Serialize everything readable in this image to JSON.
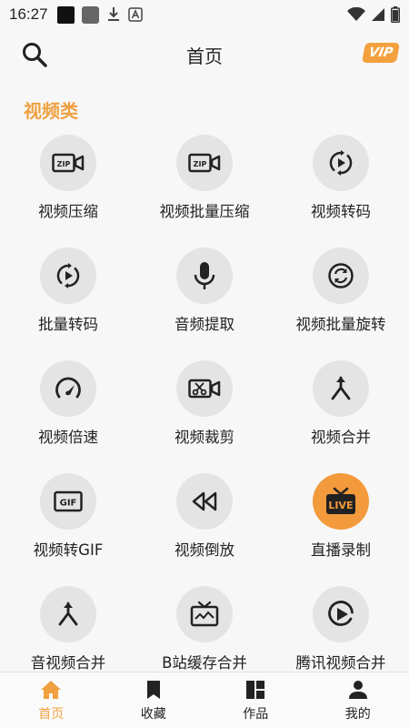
{
  "status_bar": {
    "time": "16:27"
  },
  "header": {
    "title": "首页",
    "vip_label": "VIP"
  },
  "section": {
    "title": "视频类"
  },
  "tools": [
    {
      "label": "视频压缩",
      "icon": "zip-video-icon"
    },
    {
      "label": "视频批量压缩",
      "icon": "zip-video-icon"
    },
    {
      "label": "视频转码",
      "icon": "rotate-play-icon"
    },
    {
      "label": "批量转码",
      "icon": "rotate-play-icon"
    },
    {
      "label": "音频提取",
      "icon": "microphone-icon"
    },
    {
      "label": "视频批量旋转",
      "icon": "rotate-circle-icon"
    },
    {
      "label": "视频倍速",
      "icon": "speedometer-icon"
    },
    {
      "label": "视频裁剪",
      "icon": "scissors-video-icon"
    },
    {
      "label": "视频合并",
      "icon": "merge-arrow-icon"
    },
    {
      "label": "视频转GIF",
      "icon": "gif-icon"
    },
    {
      "label": "视频倒放",
      "icon": "rewind-icon"
    },
    {
      "label": "直播录制",
      "icon": "live-tv-icon"
    },
    {
      "label": "音视频合并",
      "icon": "merge-arrow-icon"
    },
    {
      "label": "B站缓存合并",
      "icon": "tv-icon"
    },
    {
      "label": "腾讯视频合并",
      "icon": "play-circle-icon"
    }
  ],
  "bottom_nav": [
    {
      "label": "首页",
      "icon": "home-icon"
    },
    {
      "label": "收藏",
      "icon": "bookmark-icon"
    },
    {
      "label": "作品",
      "icon": "dashboard-icon"
    },
    {
      "label": "我的",
      "icon": "person-icon"
    }
  ],
  "colors": {
    "accent": "#f0a040",
    "vip": "#f3a13f",
    "icon_bg": "#e4e4e4"
  }
}
